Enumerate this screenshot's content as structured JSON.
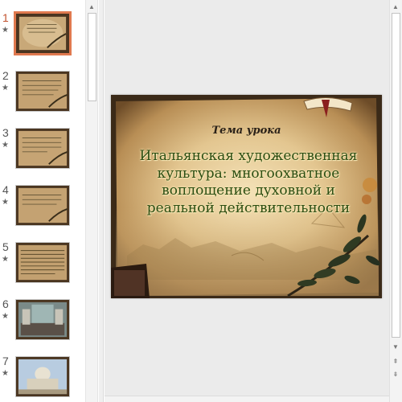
{
  "thumbnails": [
    {
      "number": "1",
      "star": "★",
      "active": true
    },
    {
      "number": "2",
      "star": "★",
      "active": false
    },
    {
      "number": "3",
      "star": "★",
      "active": false
    },
    {
      "number": "4",
      "star": "★",
      "active": false
    },
    {
      "number": "5",
      "star": "★",
      "active": false
    },
    {
      "number": "6",
      "star": "★",
      "active": false
    },
    {
      "number": "7",
      "star": "★",
      "active": false
    }
  ],
  "slide": {
    "subtitle": "Тема урока",
    "title_lines": [
      "Итальянская художественная",
      "культура: многоохватное",
      "воплощение духовной и",
      "реальной действительности"
    ]
  },
  "scroll": {
    "up_icon": "▲",
    "down_icon": "▼",
    "prev_slide_icon": "⇞",
    "next_slide_icon": "⇟"
  }
}
